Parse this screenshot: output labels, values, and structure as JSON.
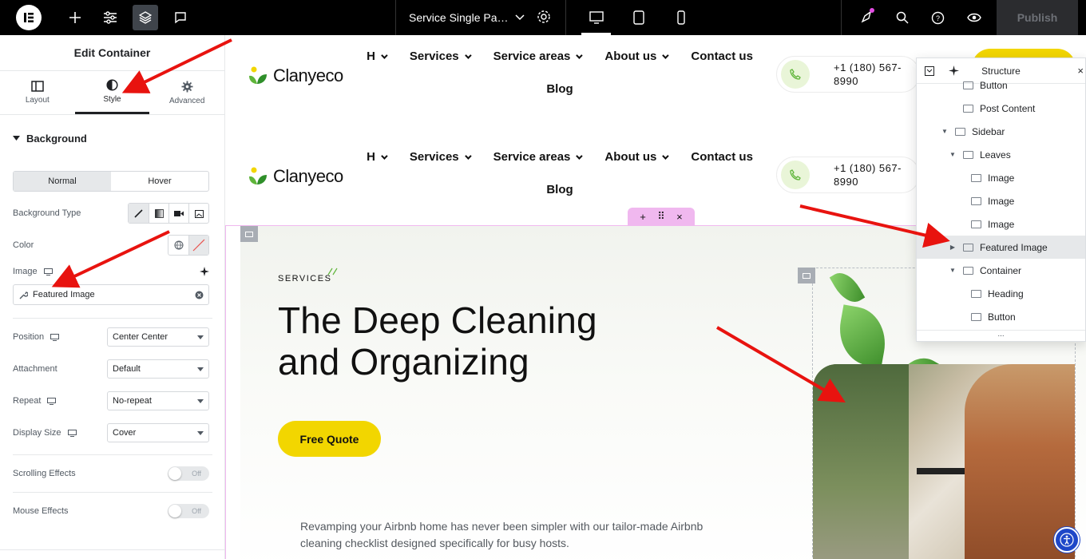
{
  "topbar": {
    "doc_title": "Service Single Pa…",
    "publish_label": "Publish"
  },
  "panel": {
    "title": "Edit Container",
    "tabs": [
      {
        "label": "Layout",
        "icon": "layout-icon"
      },
      {
        "label": "Style",
        "icon": "contrast-icon",
        "active": true
      },
      {
        "label": "Advanced",
        "icon": "gear-icon"
      }
    ],
    "background_section": "Background",
    "normal_label": "Normal",
    "hover_label": "Hover",
    "background_type_label": "Background Type",
    "color_label": "Color",
    "image_label": "Image",
    "image_value": "Featured Image",
    "position_label": "Position",
    "position_value": "Center Center",
    "attachment_label": "Attachment",
    "attachment_value": "Default",
    "repeat_label": "Repeat",
    "repeat_value": "No-repeat",
    "display_size_label": "Display Size",
    "display_size_value": "Cover",
    "scrolling_effects_label": "Scrolling Effects",
    "scrolling_effects_value": "Off",
    "mouse_effects_label": "Mouse Effects",
    "mouse_effects_value": "Off"
  },
  "site": {
    "brand": "Clanyeco",
    "nav": [
      "H",
      "Services",
      "Service areas",
      "About us",
      "Contact us",
      "Blog"
    ],
    "phone": "+1 (180) 567-",
    "phone2": "8990",
    "services_tag": "SERVICES",
    "hero_title": "The Deep Cleaning and Organizing",
    "cta": "Free Quote",
    "hero_desc": "Revamping your Airbnb home has never been simpler with our tailor-made Airbnb cleaning checklist designed specifically for busy hosts."
  },
  "structure": {
    "title": "Structure",
    "items": [
      {
        "label": "Button",
        "depth": 1,
        "icon": "button-icon"
      },
      {
        "label": "Post Content",
        "depth": 1,
        "icon": "post-content-icon"
      },
      {
        "label": "Sidebar",
        "depth": 0,
        "icon": "container-icon",
        "expanded": true
      },
      {
        "label": "Leaves",
        "depth": 1,
        "icon": "container-icon",
        "expanded": true
      },
      {
        "label": "Image",
        "depth": 2,
        "icon": "image-icon"
      },
      {
        "label": "Image",
        "depth": 2,
        "icon": "image-icon"
      },
      {
        "label": "Image",
        "depth": 2,
        "icon": "image-icon"
      },
      {
        "label": "Featured Image",
        "depth": 1,
        "icon": "container-icon",
        "collapsed": true,
        "selected": true
      },
      {
        "label": "Container",
        "depth": 1,
        "icon": "container-icon",
        "expanded": true
      },
      {
        "label": "Heading",
        "depth": 2,
        "icon": "heading-icon"
      },
      {
        "label": "Button",
        "depth": 2,
        "icon": "button-icon"
      }
    ],
    "footer": "..."
  },
  "colors": {
    "accent_yellow": "#f2d600",
    "arrow_red": "#e8130f",
    "editor_pink": "#f0b8ef"
  }
}
